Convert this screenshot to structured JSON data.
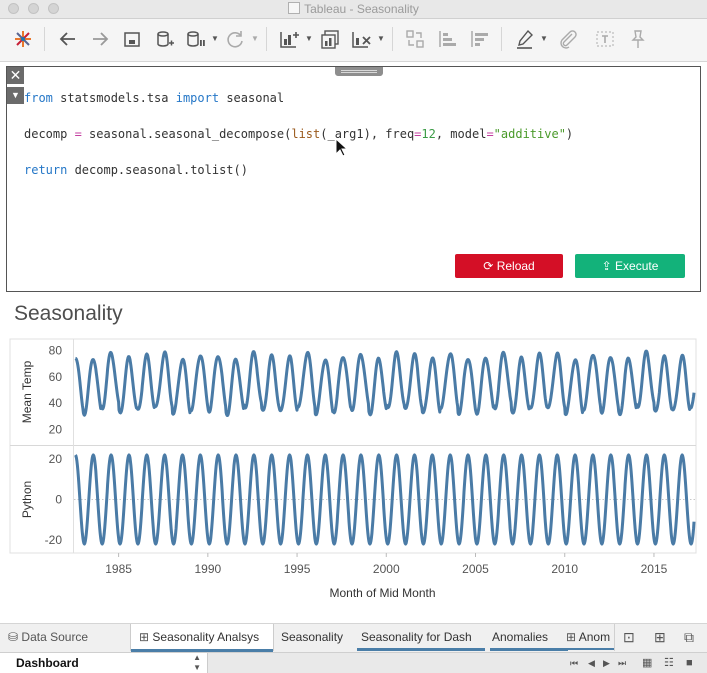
{
  "window": {
    "title": "Tableau - Seasonality"
  },
  "editor": {
    "code": {
      "l1": [
        "from",
        " statsmodels.tsa ",
        "import",
        " seasonal"
      ],
      "l2": [
        "decomp ",
        "=",
        " seasonal.",
        "seasonal_decompose",
        "(",
        "list",
        "(_arg1), freq",
        "=",
        "12",
        ", model",
        "=",
        "\"additive\"",
        ")"
      ],
      "l3": [
        "return",
        " decomp.seasonal.",
        "tolist",
        "()"
      ]
    },
    "reload_label": "Reload",
    "execute_label": "Execute",
    "accent_reload": "#d40f26",
    "accent_execute": "#13b27a"
  },
  "sheet": {
    "title": "Seasonality"
  },
  "chart_data": {
    "type": "line",
    "line_color": "#4a7ba6",
    "grid": false,
    "x": {
      "label": "Month of Mid Month",
      "ticks": [
        "1985",
        "1990",
        "1995",
        "2000",
        "2005",
        "2010",
        "2015"
      ],
      "range": [
        1982.5,
        2017.3
      ]
    },
    "panels": [
      {
        "name": "Mean Temp",
        "ylabel": "Mean Temp",
        "yticks": [
          "80",
          "60",
          "40",
          "20"
        ],
        "ylim": [
          12,
          85
        ],
        "series": {
          "start": 1982.58,
          "period_years": 1,
          "mean": 55,
          "amplitude": 21,
          "minimum_approx": 32,
          "maximum_approx": 78
        }
      },
      {
        "name": "Python",
        "ylabel": "Python",
        "yticks": [
          "20",
          "0",
          "-20"
        ],
        "ylim": [
          -24,
          24
        ],
        "zero_line": true,
        "series": {
          "start": 1982.58,
          "period_years": 1,
          "mean": 0,
          "amplitude": 22
        }
      }
    ]
  },
  "tabs": {
    "data_source": "Data Source",
    "items": [
      "Seasonality Analsys",
      "Seasonality",
      "Seasonality for Dash",
      "Anomalies",
      "Anom"
    ]
  },
  "status": {
    "dashboard_label": "Dashboard"
  }
}
